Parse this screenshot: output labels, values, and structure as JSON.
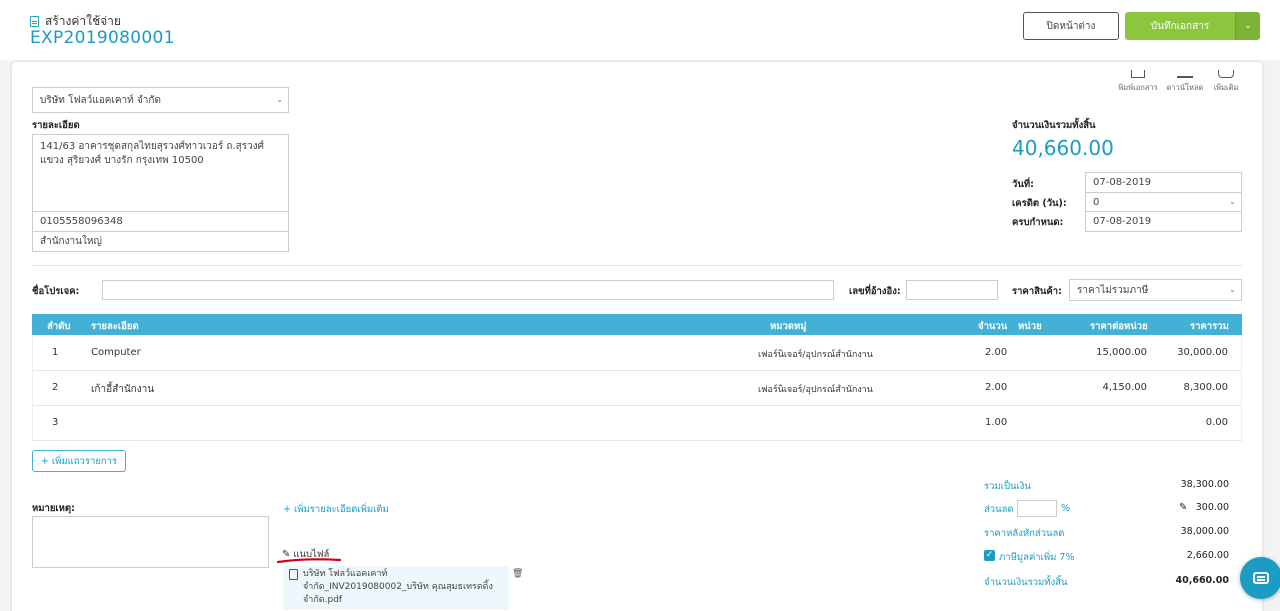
{
  "header": {
    "page_title": "สร้างค่าใช้จ่าย",
    "doc_number": "EXP2019080001",
    "close_label": "ปิดหน้าต่าง",
    "save_label": "บันทึกเอกสาร"
  },
  "top_actions": {
    "print_label": "พิมพ์เอกสาร",
    "download_label": "ดาวน์โหลด",
    "more_label": "เพิ่มเติม"
  },
  "vendor": {
    "selected": "บริษัท โฟลว์แอคเคาท์ จำกัด",
    "details_label": "รายละเอียด",
    "address": "141/63 อาคารชุดสกุลไทยสุรวงศ์ทาวเวอร์ ถ.สุรวงศ์ แขวง สุริยวงศ์ บางรัก กรุงเทพ 10500",
    "tax_id": "0105558096348",
    "branch": "สำนักงานใหญ่"
  },
  "summary_top": {
    "total_label": "จำนวนเงินรวมทั้งสิ้น",
    "total_value": "40,660.00",
    "date_label": "วันที่:",
    "date_value": "07-08-2019",
    "credit_label": "เครดิต (วัน):",
    "credit_value": "0",
    "due_label": "ครบกำหนด:",
    "due_value": "07-08-2019"
  },
  "project": {
    "project_label": "ชื่อโปรเจค:",
    "project_value": "",
    "ref_label": "เลขที่อ้างอิง:",
    "ref_value": "",
    "price_label": "ราคาสินค้า:",
    "price_value": "ราคาไม่รวมภาษี"
  },
  "table": {
    "headers": {
      "index": "ลำดับ",
      "details": "รายละเอียด",
      "category": "หมวดหมู่",
      "qty": "จำนวน",
      "unit": "หน่วย",
      "unit_price": "ราคาต่อหน่วย",
      "amount": "ราคารวม"
    },
    "rows": [
      {
        "index": "1",
        "details": "Computer",
        "category": "เฟอร์นิเจอร์/อุปกรณ์สำนักงาน",
        "qty": "2.00",
        "unit": "",
        "unit_price": "15,000.00",
        "amount": "30,000.00"
      },
      {
        "index": "2",
        "details": "เก้าอี้สำนักงาน",
        "category": "เฟอร์นิเจอร์/อุปกรณ์สำนักงาน",
        "qty": "2.00",
        "unit": "",
        "unit_price": "4,150.00",
        "amount": "8,300.00"
      },
      {
        "index": "3",
        "details": "",
        "category": "",
        "qty": "1.00",
        "unit": "",
        "unit_price": "",
        "amount": "0.00"
      }
    ],
    "add_row_label": "+ เพิ่มแถวรายการ"
  },
  "notes": {
    "remark_label": "หมายเหตุ:",
    "add_more_label": "+ เพิ่มรายละเอียดเพิ่มเติม",
    "attach_label": "แนบไฟล์",
    "file_name": "บริษัท โฟลว์แอคเคาท์ จำกัด_INV2019080002_บริษัท คุณสุมธเทรดดิ้ง จำกัด.pdf"
  },
  "summary_bottom": {
    "subtotal_label": "รวมเป็นเงิน",
    "subtotal_value": "38,300.00",
    "discount_label": "ส่วนลด",
    "discount_percent": "",
    "percent_sign": "%",
    "discount_value": "300.00",
    "after_discount_label": "ราคาหลังหักส่วนลด",
    "after_discount_value": "38,000.00",
    "vat_label": "ภาษีมูลค่าเพิ่ม 7%",
    "vat_value": "2,660.00",
    "grand_total_label": "จำนวนเงินรวมทั้งสิ้น",
    "grand_total_value": "40,660.00"
  },
  "colors": {
    "accent": "#1a9cc4",
    "table_header": "#43b0d5",
    "save_button": "#8cc63f",
    "annotation_underline": "#d0021b"
  }
}
